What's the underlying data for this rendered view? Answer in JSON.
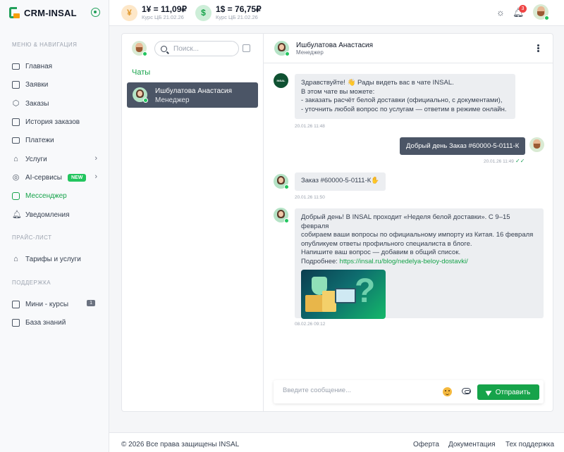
{
  "brand": {
    "name": "CRM-INSAL"
  },
  "sidebar": {
    "section_nav": "МЕНЮ & НАВИГАЦИЯ",
    "items": [
      {
        "label": "Главная",
        "icon": "monitor-icon"
      },
      {
        "label": "Заявки",
        "icon": "list-icon"
      },
      {
        "label": "Заказы",
        "icon": "box-icon"
      },
      {
        "label": "История заказов",
        "icon": "archive-icon"
      },
      {
        "label": "Платежи",
        "icon": "wallet-icon"
      },
      {
        "label": "Услуги",
        "icon": "tag-icon"
      },
      {
        "label": "AI-сервисы",
        "icon": "ai-icon",
        "badge": "NEW"
      },
      {
        "label": "Мессенджер",
        "icon": "chat-icon"
      },
      {
        "label": "Уведомления",
        "icon": "bell-icon"
      }
    ],
    "section_price": "ПРАЙС-ЛИСТ",
    "price_items": [
      {
        "label": "Тарифы и услуги",
        "icon": "tag-icon"
      }
    ],
    "section_support": "ПОДДЕРЖКА",
    "support_items": [
      {
        "label": "Мини - курсы",
        "icon": "book-icon",
        "count": "1"
      },
      {
        "label": "База знаний",
        "icon": "book-icon"
      }
    ]
  },
  "header": {
    "yuan_symbol": "¥",
    "yuan_rate": "1¥ = 11,09₽",
    "yuan_sub": "Курс ЦБ 21.02.26",
    "usd_symbol": "$",
    "usd_rate": "1$ = 76,75₽",
    "usd_sub": "Курс ЦБ 21.02.26",
    "notifications_count": "3"
  },
  "chatlist": {
    "search_placeholder": "Поиск...",
    "title": "Чаты",
    "items": [
      {
        "name": "Ишбулатова Анастасия",
        "role": "Менеджер"
      }
    ]
  },
  "conversation": {
    "name": "Ишбулатова Анастасия",
    "role": "Менеджер",
    "messages": [
      {
        "lines": [
          "Здравствуйте! 👋 Рады видеть вас в чате INSAL.",
          "В этом чате вы можете:",
          "- заказать расчёт белой доставки (официально, с документами),",
          "- уточнить любой вопрос по услугам — ответим в режиме онлайн."
        ],
        "time": "20.01.26 11:48"
      },
      {
        "text": "Добрый день  Заказ #60000-5-0111-К",
        "time": "20.01.26 11:49"
      },
      {
        "text": "Заказ #60000-5-0111-К✋",
        "time": "20.01.26 11:50"
      },
      {
        "lines": [
          "Добрый день! В INSAL проходит «Неделя белой доставки». С 9–15 февраля",
          "собираем ваши вопросы по официальному импорту из Китая. 16 февраля",
          "опубликуем ответы профильного специалиста в блоге.",
          "Напишите ваш вопрос — добавим в общий список."
        ],
        "link_prefix": "Подробнее: ",
        "link": "https://insal.ru/blog/nedelya-beloy-dostavki/",
        "time": "08.02.26 09:12"
      }
    ],
    "composer_placeholder": "Введите сообщение...",
    "send_label": "Отправить"
  },
  "footer": {
    "copyright": "© 2026 Все права защищены INSAL",
    "links": [
      "Оферта",
      "Документация",
      "Тех поддержка"
    ]
  },
  "colors": {
    "accent": "#16a34a",
    "dark_bubble": "#4b5566",
    "badge": "#ef4444"
  }
}
